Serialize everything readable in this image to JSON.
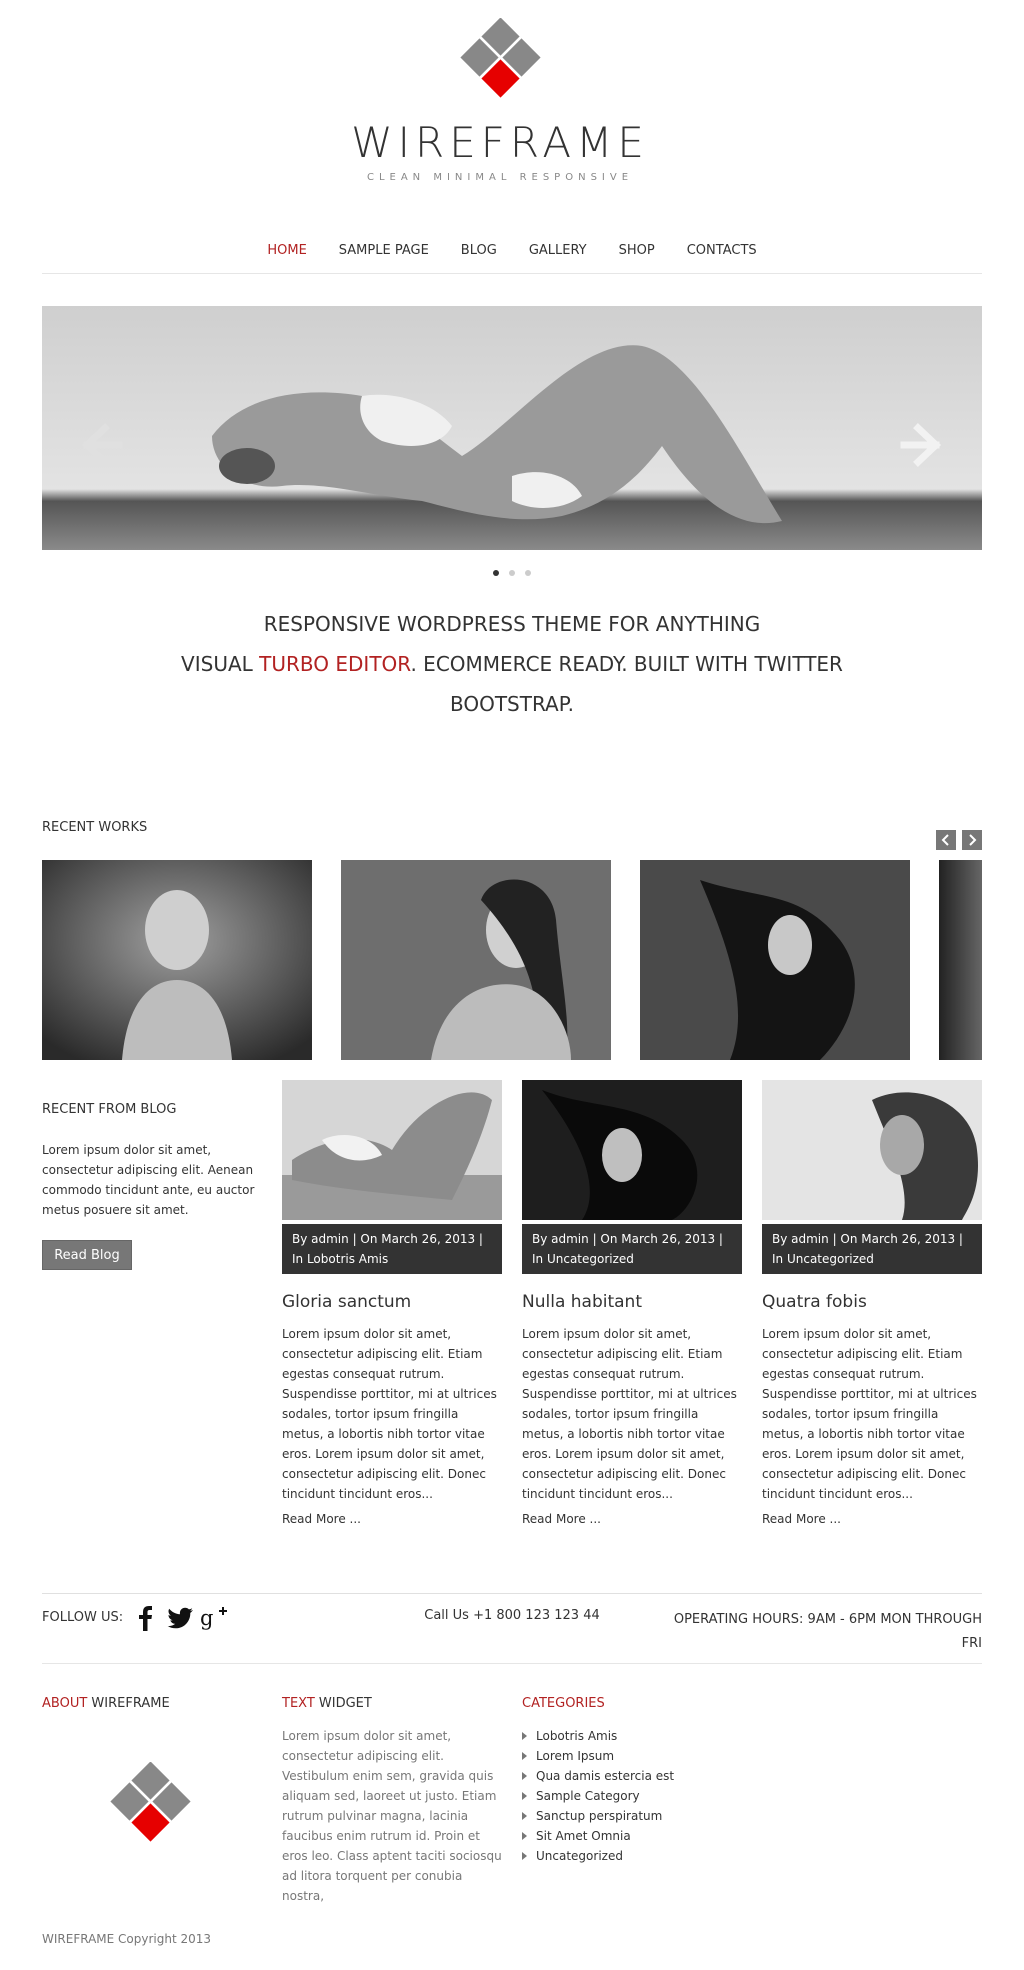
{
  "header": {
    "site_title": "WIREFRAME",
    "tagline": "CLEAN MINIMAL RESPONSIVE",
    "logo_icon": "diamond-logo-icon",
    "logo_colors": {
      "gray": "#888888",
      "red": "#e60000"
    }
  },
  "nav": {
    "items": [
      {
        "label": "HOME",
        "active": true
      },
      {
        "label": "SAMPLE PAGE",
        "active": false
      },
      {
        "label": "BLOG",
        "active": false
      },
      {
        "label": "GALLERY",
        "active": false
      },
      {
        "label": "SHOP",
        "active": false
      },
      {
        "label": "CONTACTS",
        "active": false
      }
    ]
  },
  "slider": {
    "prev_icon": "arrow-left-icon",
    "next_icon": "arrow-right-icon",
    "dot_count": 3,
    "active_dot": 1
  },
  "promo": {
    "line1": "RESPONSIVE WORDPRESS THEME FOR ANYTHING",
    "line2_pre": "VISUAL ",
    "line2_accent": "TURBO EDITOR",
    "line2_post": ". ECOMMERCE READY. BUILT WITH TWITTER",
    "line3": "BOOTSTRAP."
  },
  "recent_works": {
    "title": "RECENT WORKS",
    "prev_icon": "chevron-left-icon",
    "next_icon": "chevron-right-icon"
  },
  "blog_sidebar": {
    "title": "RECENT FROM BLOG",
    "text": "Lorem ipsum dolor sit amet, consectetur adipiscing elit. Aenean commodo tincidunt ante, eu auctor metus posuere sit amet.",
    "button": "Read Blog"
  },
  "posts": [
    {
      "meta": "By admin | On March 26, 2013 | In Lobotris Amis",
      "title": "Gloria sanctum",
      "text": "Lorem ipsum dolor sit amet, consectetur adipiscing elit. Etiam egestas consequat rutrum. Suspendisse porttitor, mi at ultrices sodales, tortor ipsum fringilla metus, a lobortis nibh tortor vitae eros. Lorem ipsum dolor sit amet, consectetur adipiscing elit. Donec tincidunt tincidunt eros...",
      "more": "Read More ..."
    },
    {
      "meta": "By admin | On March 26, 2013 | In Uncategorized",
      "title": "Nulla habitant",
      "text": "Lorem ipsum dolor sit amet, consectetur adipiscing elit. Etiam egestas consequat rutrum. Suspendisse porttitor, mi at ultrices sodales, tortor ipsum fringilla metus, a lobortis nibh tortor vitae eros. Lorem ipsum dolor sit amet, consectetur adipiscing elit. Donec tincidunt tincidunt eros...",
      "more": "Read More ..."
    },
    {
      "meta": "By admin | On March 26, 2013 | In Uncategorized",
      "title": "Quatra fobis",
      "text": "Lorem ipsum dolor sit amet, consectetur adipiscing elit. Etiam egestas consequat rutrum. Suspendisse porttitor, mi at ultrices sodales, tortor ipsum fringilla metus, a lobortis nibh tortor vitae eros. Lorem ipsum dolor sit amet, consectetur adipiscing elit. Donec tincidunt tincidunt eros...",
      "more": "Read More ..."
    }
  ],
  "follow": {
    "label": "FOLLOW US:",
    "icons": [
      "facebook-icon",
      "twitter-icon",
      "google-plus-icon"
    ],
    "call": "Call Us +1 800 123 123 44",
    "hours_line1": "OPERATING HOURS: 9AM - 6PM MON THROUGH",
    "hours_line2": "FRI"
  },
  "footer": {
    "about_accent": "ABOUT",
    "about_rest": " WIREFRAME",
    "text_accent": "TEXT",
    "text_rest": " WIDGET",
    "text_widget": "Lorem ipsum dolor sit amet, consectetur adipiscing elit. Vestibulum enim sem, gravida quis aliquam sed, laoreet ut justo. Etiam rutrum pulvinar magna, lacinia faucibus enim rutrum id. Proin et eros leo. Class aptent taciti sociosqu ad litora torquent per conubia nostra,",
    "categories_title": "CATEGORIES",
    "categories": [
      "Lobotris Amis",
      "Lorem Ipsum",
      "Qua damis estercia est",
      "Sample Category",
      "Sanctup perspiratum",
      "Sit Amet Omnia",
      "Uncategorized"
    ],
    "copyright": "WIREFRAME Copyright 2013"
  }
}
